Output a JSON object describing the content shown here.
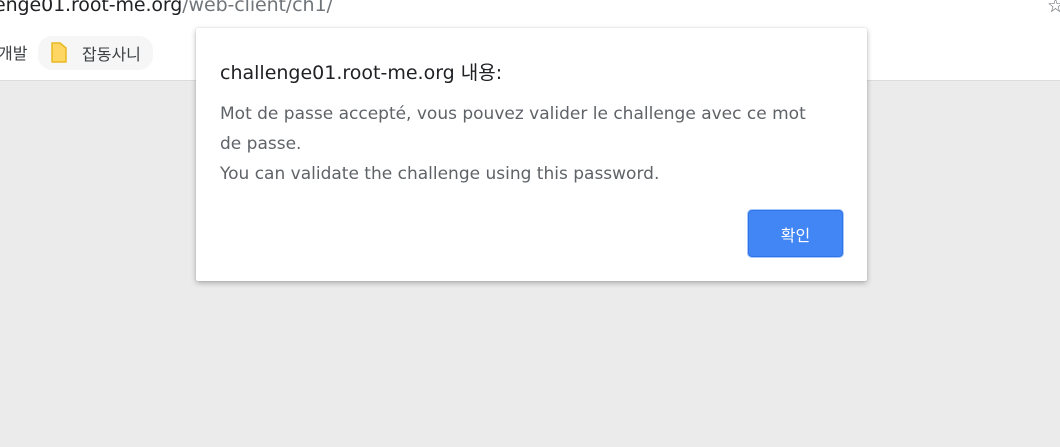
{
  "browser": {
    "url_host": "enge01.root-me.org",
    "url_path": "/web-client/ch1/",
    "star_icon": "star-icon"
  },
  "bookmarks": {
    "left_partial_label": "개발",
    "folder_label": "잡동사니",
    "folder_icon": "folder-icon",
    "folder_color": "#fdd663"
  },
  "dialog": {
    "title": "challenge01.root-me.org 내용:",
    "message_lines": [
      "Mot de passe accepté, vous pouvez valider le challenge avec ce mot",
      "de passe.",
      "You can validate the challenge using this password."
    ],
    "ok_label": "확인",
    "ok_color": "#4285f4"
  }
}
